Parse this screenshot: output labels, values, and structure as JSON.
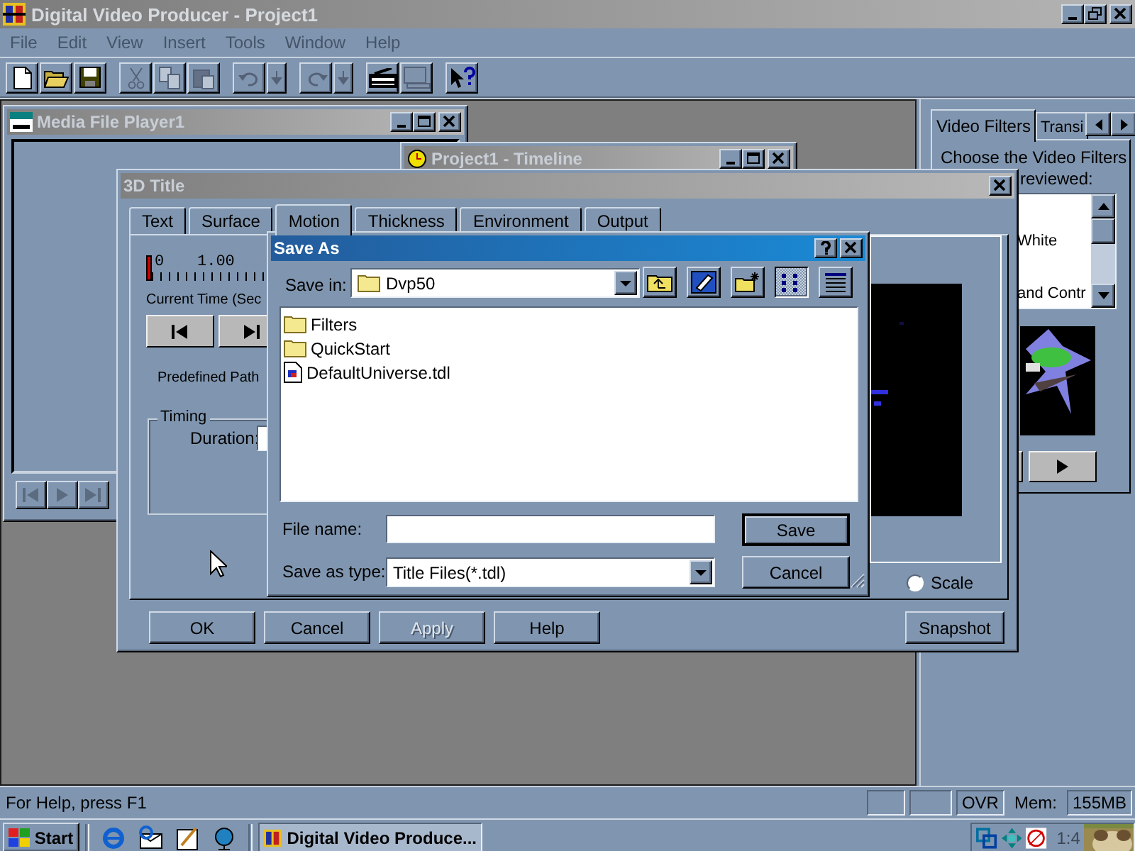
{
  "window": {
    "title": "Digital Video Producer - Project1"
  },
  "menu": [
    "File",
    "Edit",
    "View",
    "Insert",
    "Tools",
    "Window",
    "Help"
  ],
  "toolbar": [
    {
      "buttons": [
        {
          "kind": "new",
          "disabled": false
        },
        {
          "kind": "open",
          "disabled": false
        },
        {
          "kind": "save",
          "disabled": false
        }
      ]
    },
    {
      "buttons": [
        {
          "kind": "cut",
          "disabled": true
        },
        {
          "kind": "copy",
          "disabled": true
        },
        {
          "kind": "paste",
          "disabled": true
        }
      ]
    },
    {
      "buttons": [
        {
          "kind": "undo",
          "disabled": true
        },
        {
          "kind": "undo-list",
          "disabled": true
        }
      ]
    },
    {
      "buttons": [
        {
          "kind": "redo",
          "disabled": true
        },
        {
          "kind": "redo-list",
          "disabled": true
        }
      ]
    },
    {
      "buttons": [
        {
          "kind": "storyboard",
          "disabled": false
        },
        {
          "kind": "monitor",
          "disabled": true
        }
      ]
    },
    {
      "buttons": [
        {
          "kind": "help",
          "disabled": false
        }
      ]
    }
  ],
  "media_player": {
    "title": "Media File Player1",
    "transport": [
      {
        "kind": "start",
        "disabled": true
      },
      {
        "kind": "play",
        "disabled": true
      },
      {
        "kind": "end",
        "disabled": true
      }
    ]
  },
  "timeline": {
    "title": "Project1 - Timeline"
  },
  "title_dialog": {
    "title": "3D Title",
    "tabs": [
      {
        "label": "Text",
        "selected": false
      },
      {
        "label": "Surface",
        "selected": false
      },
      {
        "label": "Motion",
        "selected": true
      },
      {
        "label": "Thickness",
        "selected": false
      },
      {
        "label": "Environment",
        "selected": false
      },
      {
        "label": "Output",
        "selected": false
      }
    ],
    "time_slider": {
      "labels": [
        "0",
        "1.00"
      ],
      "level": 0
    },
    "current_time_label": "Current Time (Sec",
    "transport": [
      {
        "kind": "start"
      },
      {
        "kind": "end"
      }
    ],
    "predefined_path_label": "Predefined Path",
    "timing": {
      "legend": "Timing",
      "duration_label": "Duration:"
    },
    "preview": {
      "kind": "picture"
    },
    "scale": {
      "label": "Scale",
      "selected": false
    },
    "snapshot": "Snapshot",
    "buttons": [
      {
        "label": "OK",
        "disabled": false
      },
      {
        "label": "Cancel",
        "disabled": false
      },
      {
        "label": "Apply",
        "disabled": true
      },
      {
        "label": "Help",
        "disabled": false
      }
    ]
  },
  "save_as": {
    "title": "Save As",
    "save_in_label": "Save in:",
    "save_in_value": "Dvp50",
    "tools": [
      {
        "kind": "up-folder",
        "selected": false
      },
      {
        "kind": "desktop",
        "selected": false
      },
      {
        "kind": "new-folder",
        "selected": false
      },
      {
        "kind": "list-view",
        "selected": true
      },
      {
        "kind": "details-view",
        "selected": false
      }
    ],
    "files": [
      {
        "name": "Filters",
        "kind": "folder"
      },
      {
        "name": "QuickStart",
        "kind": "folder"
      },
      {
        "name": "DefaultUniverse.tdl",
        "kind": "file"
      }
    ],
    "file_name_label": "File name:",
    "type_label": "Save as type:",
    "type_value": "Title Files(*.tdl)",
    "buttons": [
      {
        "label": "Save",
        "default": true
      },
      {
        "label": "Cancel",
        "default": false
      }
    ]
  },
  "filters_panel": {
    "tabs": [
      {
        "label": "Video Filters",
        "selected": true
      },
      {
        "label": "Transi",
        "selected": false
      }
    ],
    "prompt": "Choose the Video Filters",
    "prompt_end": "reviewed:",
    "items": [
      "White",
      "and Contr"
    ],
    "thumbnail": {
      "kind": "picture"
    }
  },
  "status_bar": {
    "help": "For Help, press F1",
    "indicator": "OVR",
    "mem_label": "Mem:",
    "mem_value": "155MB"
  },
  "taskbar": {
    "start": "Start",
    "task": "Digital Video Produce...",
    "clock": "1:4"
  }
}
